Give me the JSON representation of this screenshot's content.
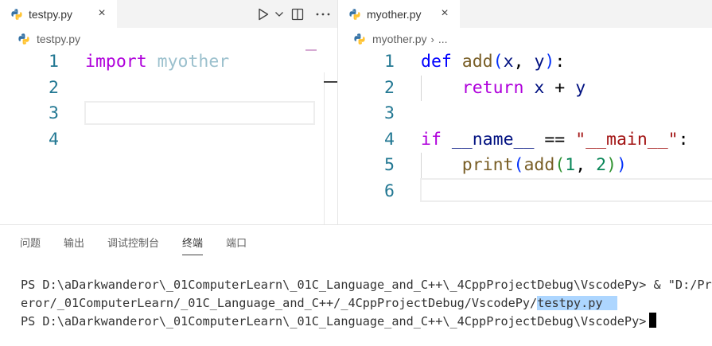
{
  "left_editor": {
    "tab": {
      "label": "testpy.py",
      "close": "×"
    },
    "breadcrumb": {
      "file": "testpy.py"
    },
    "lines": [
      {
        "n": "1",
        "tokens": [
          {
            "t": "import",
            "c": "kw-import"
          },
          {
            "t": " ",
            "c": "plain"
          },
          {
            "t": "myother",
            "c": "mod-faded"
          }
        ]
      },
      {
        "n": "2",
        "tokens": []
      },
      {
        "n": "3",
        "tokens": []
      },
      {
        "n": "4",
        "tokens": []
      }
    ]
  },
  "right_editor": {
    "tab": {
      "label": "myother.py",
      "close": "×"
    },
    "breadcrumb": {
      "file": "myother.py",
      "separator": "›",
      "more": "..."
    },
    "lines": [
      {
        "n": "1",
        "tokens": [
          {
            "t": "def",
            "c": "kw"
          },
          {
            "t": " ",
            "c": "plain"
          },
          {
            "t": "add",
            "c": "fn"
          },
          {
            "t": "(",
            "c": "paren"
          },
          {
            "t": "x",
            "c": "param"
          },
          {
            "t": ", ",
            "c": "plain"
          },
          {
            "t": "y",
            "c": "param"
          },
          {
            "t": ")",
            "c": "paren"
          },
          {
            "t": ":",
            "c": "plain"
          }
        ]
      },
      {
        "n": "2",
        "tokens": [
          {
            "t": "    ",
            "c": "plain"
          },
          {
            "t": "return",
            "c": "ctrl"
          },
          {
            "t": " ",
            "c": "plain"
          },
          {
            "t": "x",
            "c": "param"
          },
          {
            "t": " + ",
            "c": "plain"
          },
          {
            "t": "y",
            "c": "param"
          }
        ]
      },
      {
        "n": "3",
        "tokens": []
      },
      {
        "n": "4",
        "tokens": [
          {
            "t": "if",
            "c": "ctrl"
          },
          {
            "t": " ",
            "c": "plain"
          },
          {
            "t": "__name__",
            "c": "dunder"
          },
          {
            "t": " == ",
            "c": "plain"
          },
          {
            "t": "\"__main__\"",
            "c": "str"
          },
          {
            "t": ":",
            "c": "plain"
          }
        ]
      },
      {
        "n": "5",
        "tokens": [
          {
            "t": "    ",
            "c": "plain"
          },
          {
            "t": "print",
            "c": "fn"
          },
          {
            "t": "(",
            "c": "paren"
          },
          {
            "t": "add",
            "c": "fn"
          },
          {
            "t": "(",
            "c": "paren2"
          },
          {
            "t": "1",
            "c": "num"
          },
          {
            "t": ", ",
            "c": "plain"
          },
          {
            "t": "2",
            "c": "num"
          },
          {
            "t": ")",
            "c": "paren2"
          },
          {
            "t": ")",
            "c": "paren"
          }
        ]
      },
      {
        "n": "6",
        "tokens": []
      }
    ]
  },
  "editor_actions": {
    "run_icon": "run-python-file-icon",
    "dropdown_icon": "chevron-down-icon",
    "split_icon": "split-editor-icon",
    "more_icon": "more-actions-icon"
  },
  "panel": {
    "tabs": [
      {
        "label": "问题",
        "active": false
      },
      {
        "label": "输出",
        "active": false
      },
      {
        "label": "调试控制台",
        "active": false
      },
      {
        "label": "终端",
        "active": true
      },
      {
        "label": "端口",
        "active": false
      }
    ],
    "terminal": {
      "line1": "PS D:\\aDarkwanderor\\_01ComputerLearn\\_01C_Language_and_C++\\_4CppProjectDebug\\VscodePy> & \"D:/Prog",
      "line2_prefix": "eror/_01ComputerLearn/_01C_Language_and_C++/_4CppProjectDebug/VscodePy/",
      "line2_selected": "testpy.py  ",
      "line3": "PS D:\\aDarkwanderor\\_01ComputerLearn\\_01C_Language_and_C++\\_4CppProjectDebug\\VscodePy>"
    }
  }
}
